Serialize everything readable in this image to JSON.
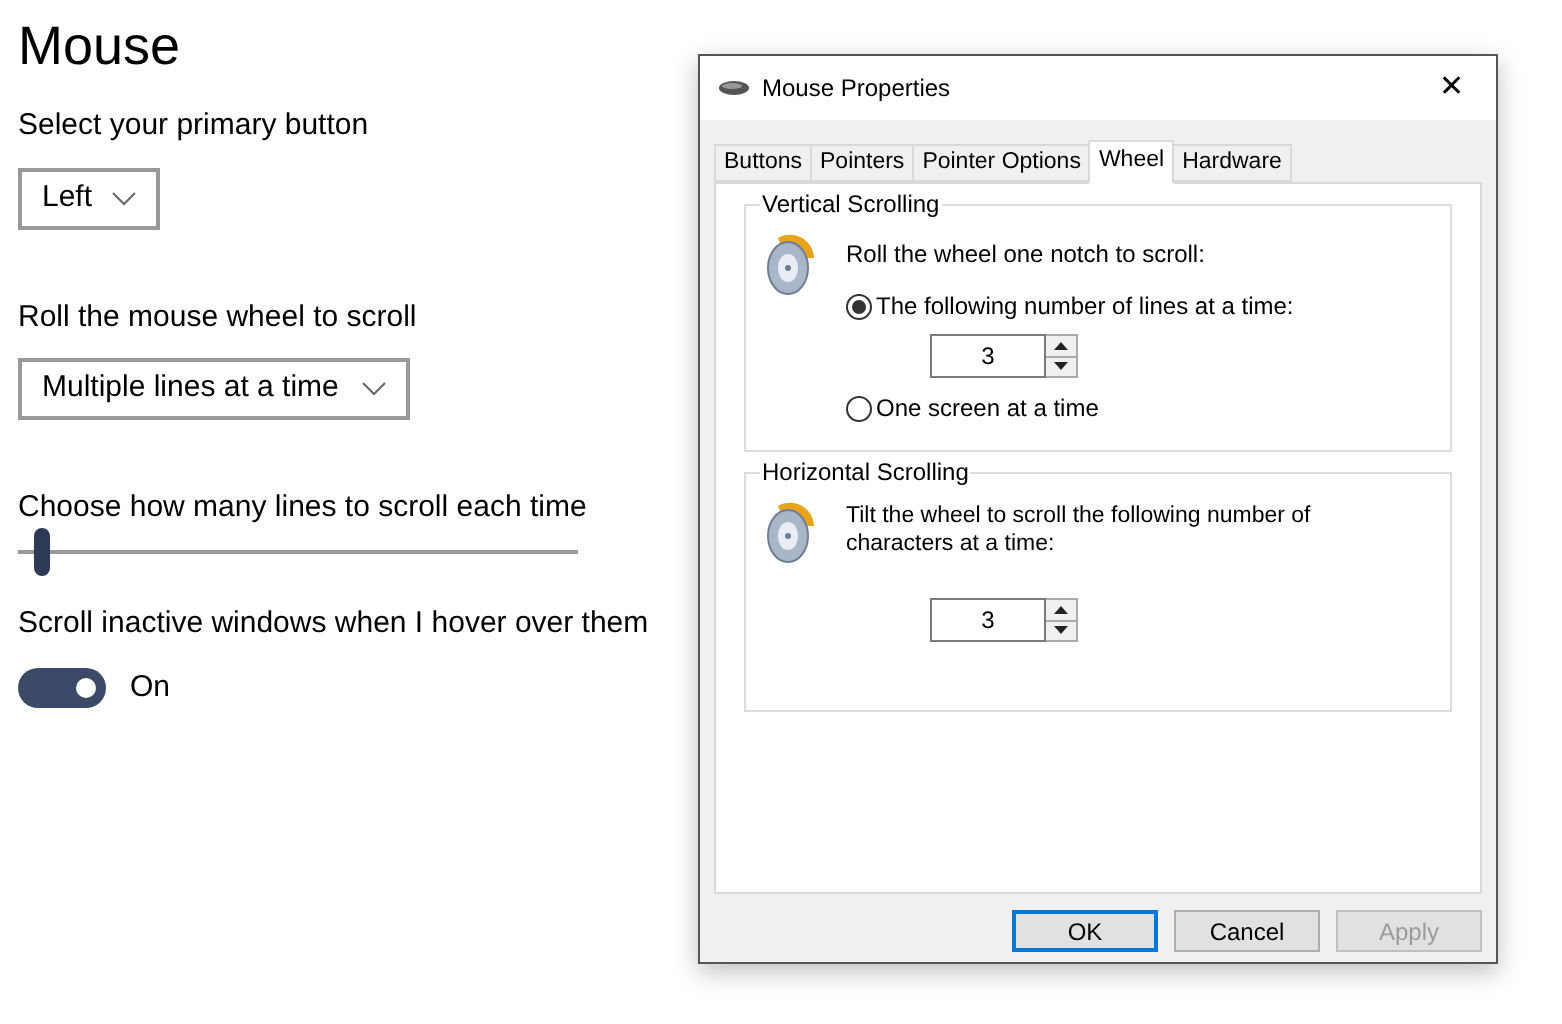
{
  "settings": {
    "title": "Mouse",
    "primary_button": {
      "label": "Select your primary button",
      "value": "Left"
    },
    "scroll_mode": {
      "label": "Roll the mouse wheel to scroll",
      "value": "Multiple lines at a time"
    },
    "lines_slider": {
      "label": "Choose how many lines to scroll each time",
      "level": 0.03
    },
    "inactive_scroll": {
      "label": "Scroll inactive windows when I hover over them",
      "on": true,
      "state_text": "On"
    }
  },
  "dialog": {
    "title": "Mouse Properties",
    "close": "✕",
    "tabs": [
      {
        "label": "Buttons",
        "selected": false
      },
      {
        "label": "Pointers",
        "selected": false
      },
      {
        "label": "Pointer Options",
        "selected": false
      },
      {
        "label": "Wheel",
        "selected": true
      },
      {
        "label": "Hardware",
        "selected": false
      }
    ],
    "vertical": {
      "title": "Vertical Scrolling",
      "prompt": "Roll the wheel one notch to scroll:",
      "options": [
        {
          "label": "The following number of lines at a time:",
          "selected": true
        },
        {
          "label": "One screen at a time",
          "selected": false
        }
      ],
      "lines": "3"
    },
    "horizontal": {
      "title": "Horizontal Scrolling",
      "prompt": "Tilt the wheel to scroll the following number of characters at a time:",
      "chars": "3"
    },
    "buttons": [
      {
        "label": "OK",
        "kind": "default",
        "disabled": false
      },
      {
        "label": "Cancel",
        "kind": "normal",
        "disabled": false
      },
      {
        "label": "Apply",
        "kind": "normal",
        "disabled": true
      }
    ]
  }
}
